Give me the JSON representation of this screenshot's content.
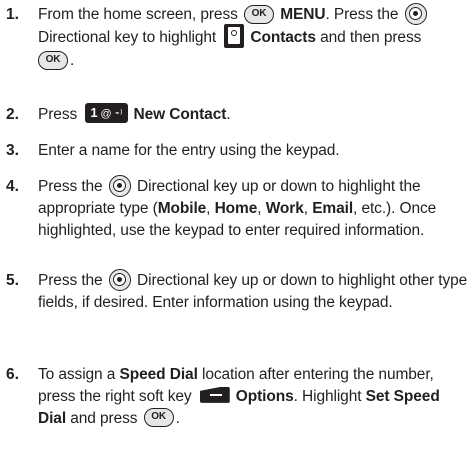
{
  "steps": [
    {
      "number": "1.",
      "t1": "From the home screen, press",
      "menu": "MENU",
      "t2": ". Press the",
      "t3": "Directional key to highlight",
      "contacts": "Contacts",
      "t4": "and then press",
      "t5": "."
    },
    {
      "number": "2.",
      "t1": "Press",
      "key_digit": "1",
      "key_sym": "@ ⁃⁾",
      "label": "New Contact",
      "t2": "."
    },
    {
      "number": "3.",
      "t1": "Enter a name for the entry using the keypad."
    },
    {
      "number": "4.",
      "t1": "Press the",
      "t2": "Directional key up or down to highlight the appropriate type (",
      "mobile": "Mobile",
      "c1": ", ",
      "home": "Home",
      "c2": ", ",
      "work": "Work",
      "c3": ", ",
      "email": "Email",
      "t3": ", etc.). Once highlighted, use the keypad to enter required information."
    },
    {
      "number": "5.",
      "t1": "Press the",
      "t2": "Directional key up or down to highlight other type fields, if desired. Enter information using the keypad."
    },
    {
      "number": "6.",
      "t1": "To assign a",
      "speed_dial": "Speed Dial",
      "t2": "location after entering the number, press the right soft key",
      "options": "Options",
      "t3": ". Highlight",
      "set_speed_dial": "Set Speed Dial",
      "t4": "and press",
      "t5": "."
    }
  ],
  "icons": {
    "ok": "OK",
    "ok_icon_name": "ok-key-icon",
    "nav_icon_name": "directional-key-icon",
    "contacts_icon_name": "contacts-icon",
    "soft_icon_name": "right-soft-key-icon"
  }
}
